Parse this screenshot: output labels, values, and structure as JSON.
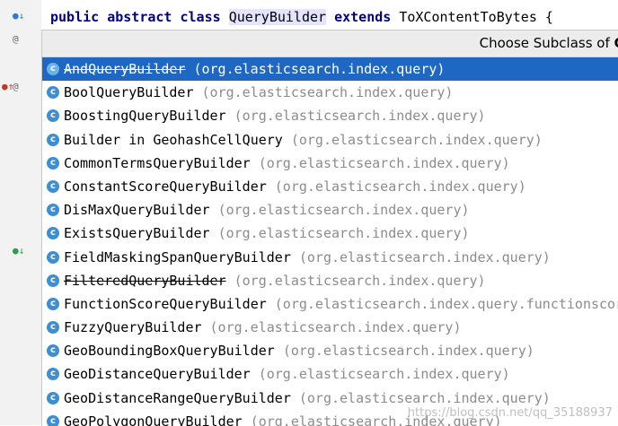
{
  "editor": {
    "code": {
      "kw1": "public abstract class",
      "class_name": "QueryBuilder",
      "kw2": "extends",
      "parent": "ToXContentToBytes",
      "brace": "{"
    },
    "gutter_marks": [
      "@",
      "@",
      "@"
    ]
  },
  "popup": {
    "title_prefix": "Choose Subclass of",
    "title_bold": "Qu",
    "items": [
      {
        "name": "AndQueryBuilder",
        "pkg": "(org.elasticsearch.index.query)",
        "deprecated": true,
        "selected": true
      },
      {
        "name": "BoolQueryBuilder",
        "pkg": "(org.elasticsearch.index.query)"
      },
      {
        "name": "BoostingQueryBuilder",
        "pkg": "(org.elasticsearch.index.query)"
      },
      {
        "name": "Builder in GeohashCellQuery",
        "pkg": "(org.elasticsearch.index.query)"
      },
      {
        "name": "CommonTermsQueryBuilder",
        "pkg": "(org.elasticsearch.index.query)"
      },
      {
        "name": "ConstantScoreQueryBuilder",
        "pkg": "(org.elasticsearch.index.query)"
      },
      {
        "name": "DisMaxQueryBuilder",
        "pkg": "(org.elasticsearch.index.query)"
      },
      {
        "name": "ExistsQueryBuilder",
        "pkg": "(org.elasticsearch.index.query)"
      },
      {
        "name": "FieldMaskingSpanQueryBuilder",
        "pkg": "(org.elasticsearch.index.query)"
      },
      {
        "name": "FilteredQueryBuilder",
        "pkg": "(org.elasticsearch.index.query)",
        "deprecated": true
      },
      {
        "name": "FunctionScoreQueryBuilder",
        "pkg": "(org.elasticsearch.index.query.functionscor"
      },
      {
        "name": "FuzzyQueryBuilder",
        "pkg": "(org.elasticsearch.index.query)"
      },
      {
        "name": "GeoBoundingBoxQueryBuilder",
        "pkg": "(org.elasticsearch.index.query)"
      },
      {
        "name": "GeoDistanceQueryBuilder",
        "pkg": "(org.elasticsearch.index.query)"
      },
      {
        "name": "GeoDistanceRangeQueryBuilder",
        "pkg": "(org.elasticsearch.index.query)"
      },
      {
        "name": "GeoPolygonQueryBuilder",
        "pkg": "(org.elasticsearch.index.query)"
      }
    ]
  },
  "watermark": "https://blog.csdn.net/qq_35188937",
  "colors": {
    "selection": "#1e68c4",
    "icon": "#3d8fd1",
    "package_text": "#8c8c8c",
    "keyword": "#000080"
  }
}
